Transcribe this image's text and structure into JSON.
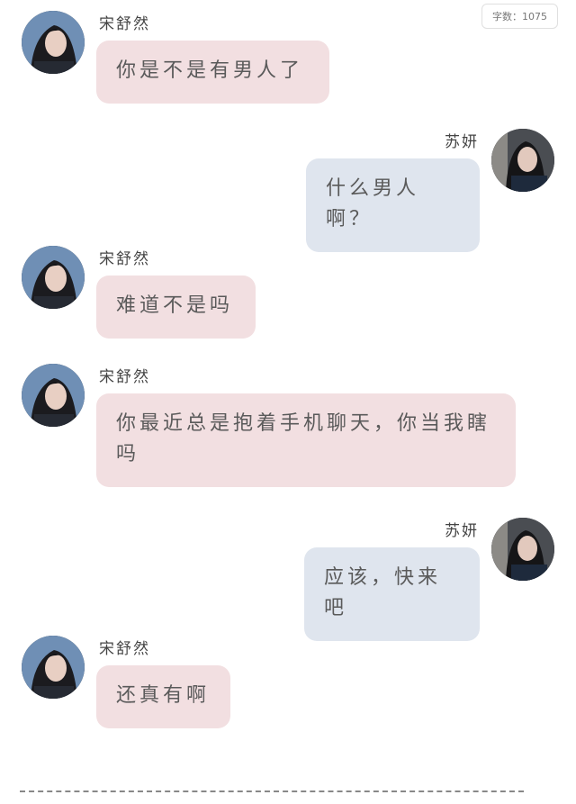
{
  "word_count": "字数：1075",
  "messages": [
    {
      "side": "left",
      "name": "宋舒然",
      "text": "你是不是有男人了"
    },
    {
      "side": "right",
      "name": "苏妍",
      "text": "什么男人啊？"
    },
    {
      "side": "left",
      "name": "宋舒然",
      "text": "难道不是吗"
    },
    {
      "side": "left",
      "name": "宋舒然",
      "text": "你最近总是抱着手机聊天，你当我瞎吗"
    },
    {
      "side": "right",
      "name": "苏妍",
      "text": "应该，快来吧"
    },
    {
      "side": "left",
      "name": "宋舒然",
      "text": "还真有啊"
    }
  ]
}
